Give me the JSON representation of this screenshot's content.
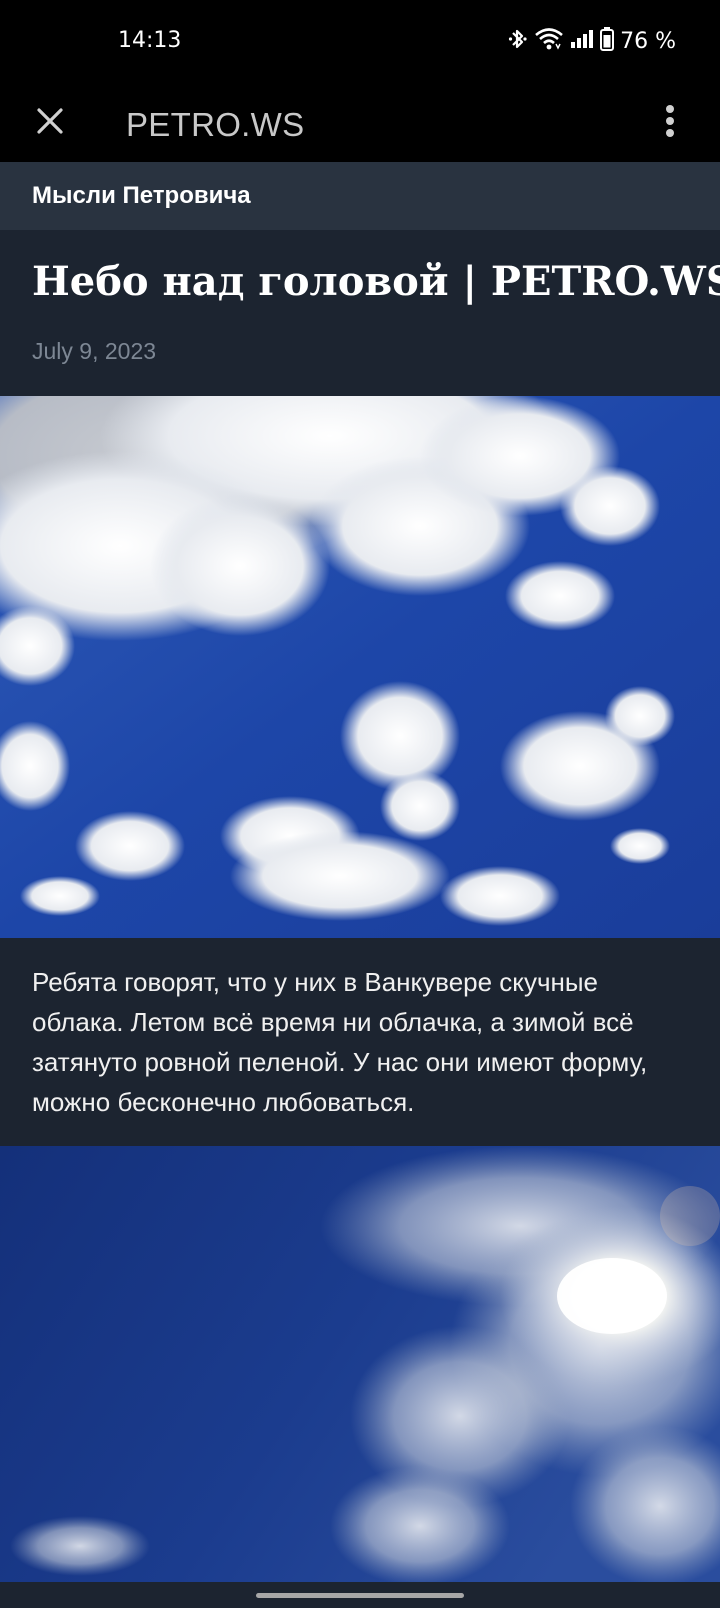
{
  "status_bar": {
    "time": "14:13",
    "battery_percent": "76 %",
    "icons": [
      "bluetooth-icon",
      "wifi-icon",
      "signal-icon",
      "battery-icon"
    ]
  },
  "app_bar": {
    "title": "PETRO.WS",
    "close_icon": "close-icon",
    "menu_icon": "more-vert-icon"
  },
  "section": {
    "label": "Мысли Петровича"
  },
  "article": {
    "title": "Небо над головой | PETRO.WS",
    "date": "July 9, 2023",
    "paragraph": "Ребята говорят, что у них в Ванкувере скучные облака. Летом всё время ни облачка, а зимой всё затянуто ровной пеленой. У нас они имеют форму, можно бесконечно любоваться."
  },
  "colors": {
    "top_bar": "#000000",
    "section_header_bg": "#293340",
    "page_bg": "#1c2430",
    "date_text": "#7d8794",
    "app_title": "#c8c8c8"
  }
}
